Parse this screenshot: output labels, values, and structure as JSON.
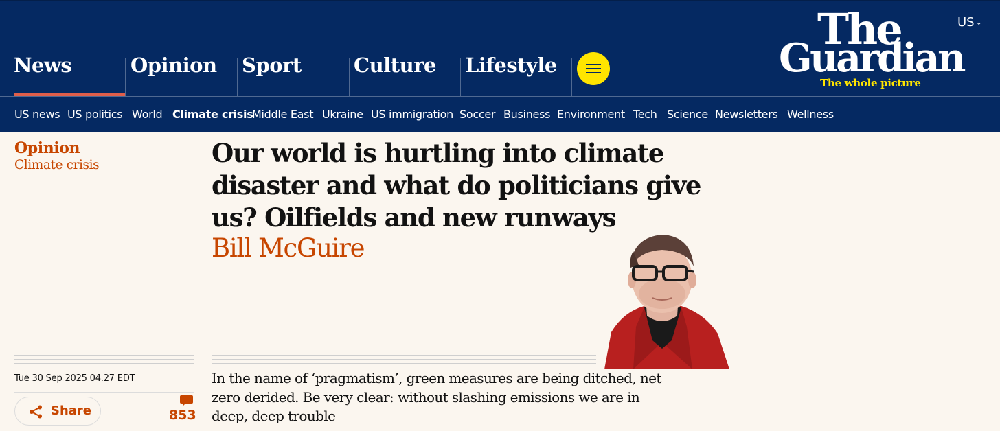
{
  "header": {
    "pillars": [
      {
        "label": "News",
        "active": true
      },
      {
        "label": "Opinion",
        "active": false
      },
      {
        "label": "Sport",
        "active": false
      },
      {
        "label": "Culture",
        "active": false
      },
      {
        "label": "Lifestyle",
        "active": false
      }
    ],
    "menu_icon": "hamburger-icon",
    "edition": "US",
    "logo": {
      "line1": "The",
      "line2": "Guardian",
      "tagline": "The whole picture"
    },
    "subnav": [
      {
        "label": "US news",
        "active": false
      },
      {
        "label": "US politics",
        "active": false
      },
      {
        "label": "World",
        "active": false
      },
      {
        "label": "Climate crisis",
        "active": true
      },
      {
        "label": "Middle East",
        "active": false
      },
      {
        "label": "Ukraine",
        "active": false
      },
      {
        "label": "US immigration",
        "active": false
      },
      {
        "label": "Soccer",
        "active": false
      },
      {
        "label": "Business",
        "active": false
      },
      {
        "label": "Environment",
        "active": false
      },
      {
        "label": "Tech",
        "active": false
      },
      {
        "label": "Science",
        "active": false
      },
      {
        "label": "Newsletters",
        "active": false
      },
      {
        "label": "Wellness",
        "active": false
      }
    ],
    "colors": {
      "background": "#052962",
      "accent_yellow": "#ffe500",
      "active_underline": "#e05e4a"
    }
  },
  "article": {
    "section": "Opinion",
    "series": "Climate crisis",
    "headline": "Our world is hurtling into climate disaster and what do politicians give us? Oilfields and new runways",
    "byline": "Bill McGuire",
    "standfirst": "In the name of ‘pragmatism’, green measures are being ditched, net zero derided. Be very clear: without slashing emissions we are in deep, deep trouble",
    "dateline": "Tue 30 Sep 2025 04.27 EDT",
    "share_label": "Share",
    "share_icon": "share-icon",
    "comment_icon": "comment-icon",
    "comment_count": "853",
    "colors": {
      "opinion_accent": "#c74600",
      "page_background": "#fbf6ef"
    }
  }
}
